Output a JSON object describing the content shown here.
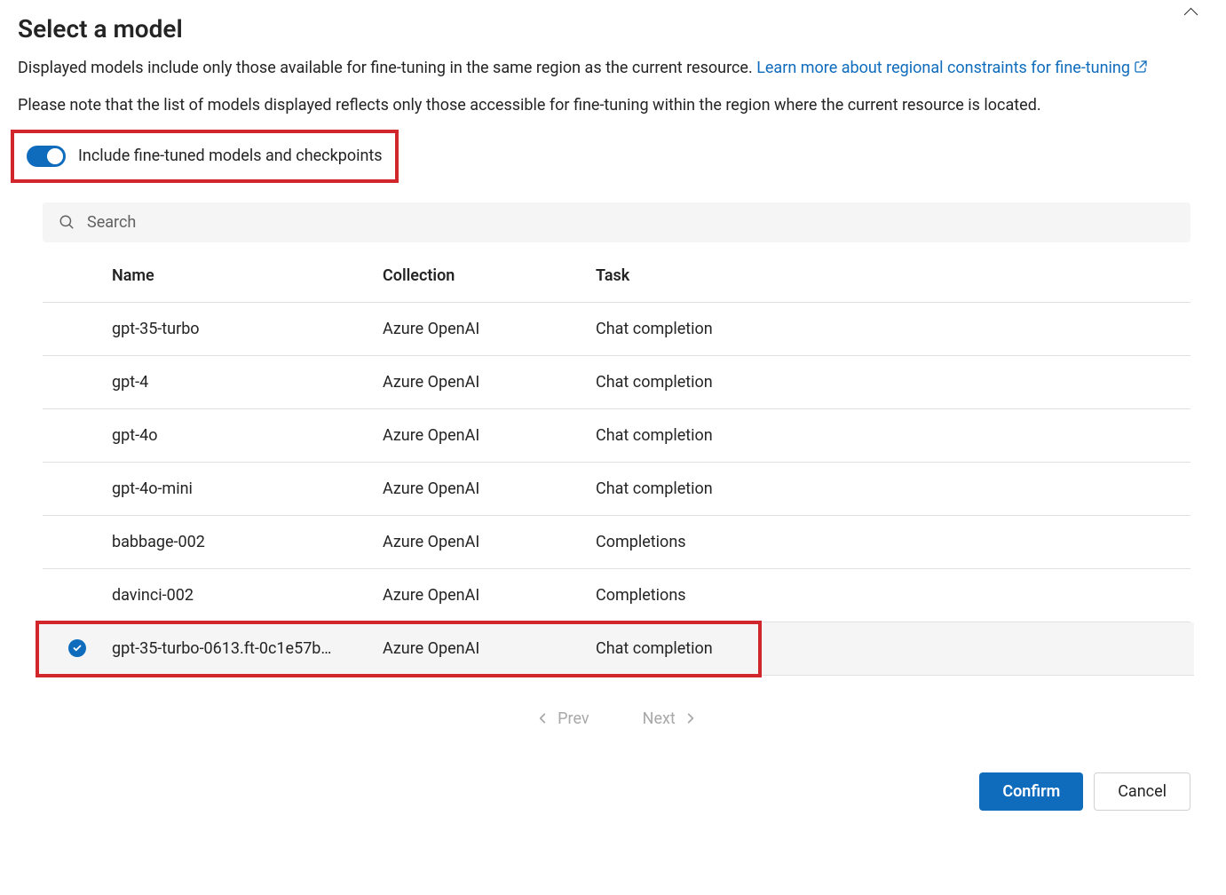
{
  "header": {
    "title": "Select a model"
  },
  "description": {
    "intro": "Displayed models include only those available for fine-tuning in the same region as the current resource. ",
    "link_text": "Learn more about regional constraints for fine-tuning"
  },
  "note_text": "Please note that the list of models displayed reflects only those accessible for fine-tuning within the region where the current resource is located.",
  "toggle": {
    "label": "Include fine-tuned models and checkpoints",
    "enabled": true
  },
  "search": {
    "placeholder": "Search",
    "value": ""
  },
  "table": {
    "headers": {
      "name": "Name",
      "collection": "Collection",
      "task": "Task"
    },
    "rows": [
      {
        "name": "gpt-35-turbo",
        "collection": "Azure OpenAI",
        "task": "Chat completion",
        "selected": false
      },
      {
        "name": "gpt-4",
        "collection": "Azure OpenAI",
        "task": "Chat completion",
        "selected": false
      },
      {
        "name": "gpt-4o",
        "collection": "Azure OpenAI",
        "task": "Chat completion",
        "selected": false
      },
      {
        "name": "gpt-4o-mini",
        "collection": "Azure OpenAI",
        "task": "Chat completion",
        "selected": false
      },
      {
        "name": "babbage-002",
        "collection": "Azure OpenAI",
        "task": "Completions",
        "selected": false
      },
      {
        "name": "davinci-002",
        "collection": "Azure OpenAI",
        "task": "Completions",
        "selected": false
      },
      {
        "name": "gpt-35-turbo-0613.ft-0c1e57b…",
        "collection": "Azure OpenAI",
        "task": "Chat completion",
        "selected": true
      }
    ]
  },
  "pagination": {
    "prev": "Prev",
    "next": "Next"
  },
  "footer": {
    "confirm": "Confirm",
    "cancel": "Cancel"
  }
}
